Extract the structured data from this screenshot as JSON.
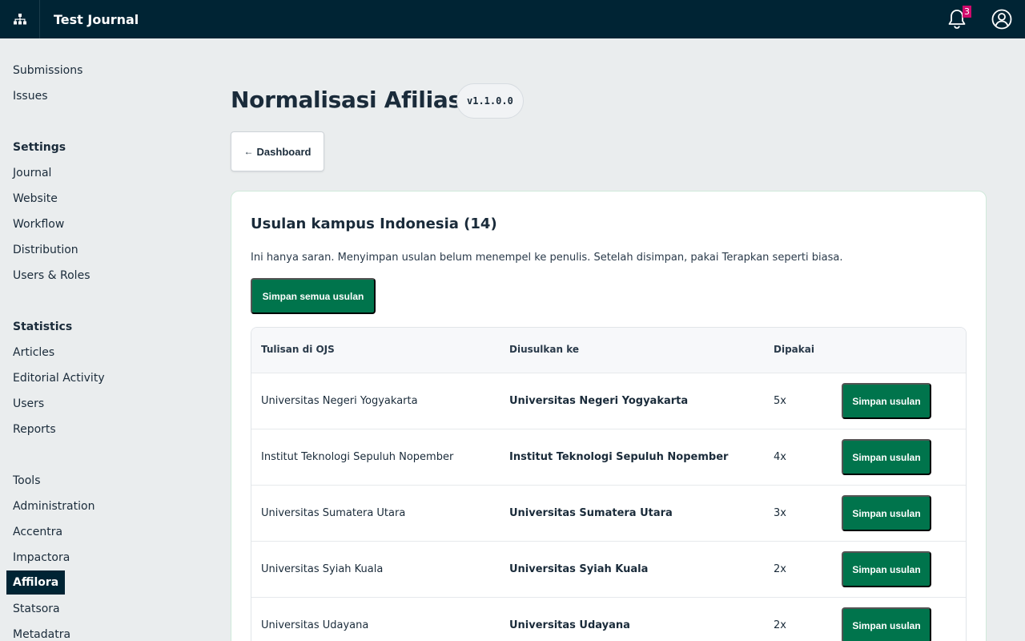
{
  "topbar": {
    "title": "Test Journal",
    "notification_count": "3"
  },
  "sidebar": {
    "items_top": [
      {
        "label": "Submissions"
      },
      {
        "label": "Issues"
      }
    ],
    "settings_heading": "Settings",
    "settings_items": [
      {
        "label": "Journal"
      },
      {
        "label": "Website"
      },
      {
        "label": "Workflow"
      },
      {
        "label": "Distribution"
      },
      {
        "label": "Users & Roles"
      }
    ],
    "statistics_heading": "Statistics",
    "statistics_items": [
      {
        "label": "Articles"
      },
      {
        "label": "Editorial Activity"
      },
      {
        "label": "Users"
      },
      {
        "label": "Reports"
      }
    ],
    "tools_items": [
      {
        "label": "Tools"
      },
      {
        "label": "Administration"
      },
      {
        "label": "Accentra"
      },
      {
        "label": "Impactora"
      },
      {
        "label": "Affilora",
        "active": true
      },
      {
        "label": "Statsora"
      },
      {
        "label": "Metadatra"
      }
    ]
  },
  "main": {
    "title": "Normalisasi Afiliasi",
    "version": "v1.1.0.0",
    "dashboard_button": "Dashboard",
    "dashboard_arrow": "←",
    "card": {
      "title": "Usulan kampus Indonesia (14)",
      "description": "Ini hanya saran. Menyimpan usulan belum menempel ke penulis. Setelah disimpan, pakai Terapkan seperti biasa.",
      "save_all_label": "Simpan semua usulan",
      "table": {
        "headers": [
          "Tulisan di OJS",
          "Diusulkan ke",
          "Dipakai",
          ""
        ],
        "row_button_label": "Simpan usulan",
        "rows": [
          {
            "original": "Universitas Negeri Yogyakarta",
            "suggested": "Universitas Negeri Yogyakarta",
            "used": "5x",
            "button": "Simpan usulan"
          },
          {
            "original": "Institut Teknologi Sepuluh Nopember",
            "suggested": "Institut Teknologi Sepuluh Nopember",
            "used": "4x",
            "button": "Simpan usulan"
          },
          {
            "original": "Universitas Sumatera Utara",
            "suggested": "Universitas Sumatera Utara",
            "used": "3x",
            "button": "Simpan usulan"
          },
          {
            "original": "Universitas Syiah Kuala",
            "suggested": "Universitas Syiah Kuala",
            "used": "2x",
            "button": "Simpan usulan"
          },
          {
            "original": "Universitas Udayana",
            "suggested": "Universitas Udayana",
            "used": "2x",
            "button": "Simpan usulan"
          }
        ]
      }
    }
  },
  "colors": {
    "topbar_bg": "#002434",
    "primary_button": "#00744c",
    "badge": "#d00a6c",
    "page_bg": "#eaedee"
  }
}
